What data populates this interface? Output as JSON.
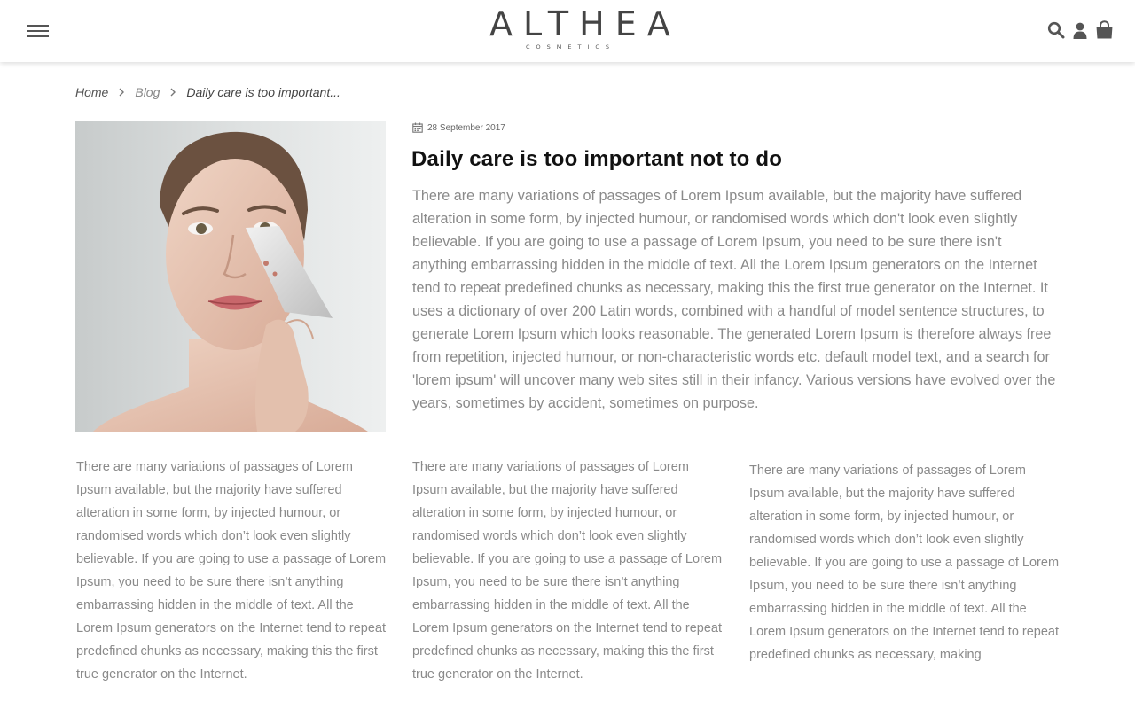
{
  "header": {
    "brand": "ALTHEA",
    "brand_sub": "COSMETICS",
    "icons": [
      "menu-icon",
      "search-icon",
      "user-icon",
      "shopping-bag-icon"
    ]
  },
  "breadcrumb": {
    "home": "Home",
    "blog": "Blog",
    "current": "Daily care is too important..."
  },
  "post": {
    "date": "28 September 2017",
    "title": "Daily care is too important not to do",
    "lead": "There are many variations of passages of Lorem Ipsum available, but the majority have suffered alteration in some form, by injected humour, or randomised words which don't look even slightly believable. If you are going to use a passage of Lorem Ipsum, you need to be sure there isn't anything embarrassing hidden in the middle of text. All the Lorem Ipsum generators on the Internet tend to repeat predefined chunks as necessary, making this the first true generator on the Internet. It uses a dictionary of over 200 Latin words, combined with a handful of model sentence structures, to generate Lorem Ipsum which looks reasonable. The generated Lorem Ipsum is therefore always free from repetition, injected humour, or non-characteristic words etc. default model text, and a search for 'lorem ipsum' will uncover many web sites still in their infancy. Various versions have evolved over the years, sometimes by accident, sometimes on purpose.",
    "columns": [
      "There are many variations of passages of Lorem Ipsum available, but the majority have suffered alteration in some form, by injected humour, or randomised words which don’t look even slightly believable. If you are going to use a passage of Lorem Ipsum, you need to be sure there isn’t anything embarrassing hidden in the middle of text. All the Lorem Ipsum generators on the Internet tend to repeat predefined chunks as necessary, making this the first true generator on the Internet.",
      "There are many variations of passages of Lorem Ipsum available, but the majority have suffered alteration in some form, by injected humour, or randomised words which don’t look even slightly believable. If you are going to use a passage of Lorem Ipsum, you need to be sure there isn’t anything embarrassing hidden in the middle of text. All the Lorem Ipsum generators on the Internet tend to repeat predefined chunks as necessary, making this the first true generator on the Internet.",
      "There are many variations of passages of Lorem Ipsum available, but the majority have suffered alteration in some form, by injected humour, or randomised words which don’t look even slightly believable. If you are going to use a passage of Lorem Ipsum, you need to be sure there isn’t anything embarrassing hidden in the middle of text. All the Lorem Ipsum generators on the Internet tend to repeat predefined chunks as necessary, making"
    ]
  },
  "colors": {
    "title": "#111111",
    "body_text": "#8a8a8a",
    "icon": "#555555"
  }
}
